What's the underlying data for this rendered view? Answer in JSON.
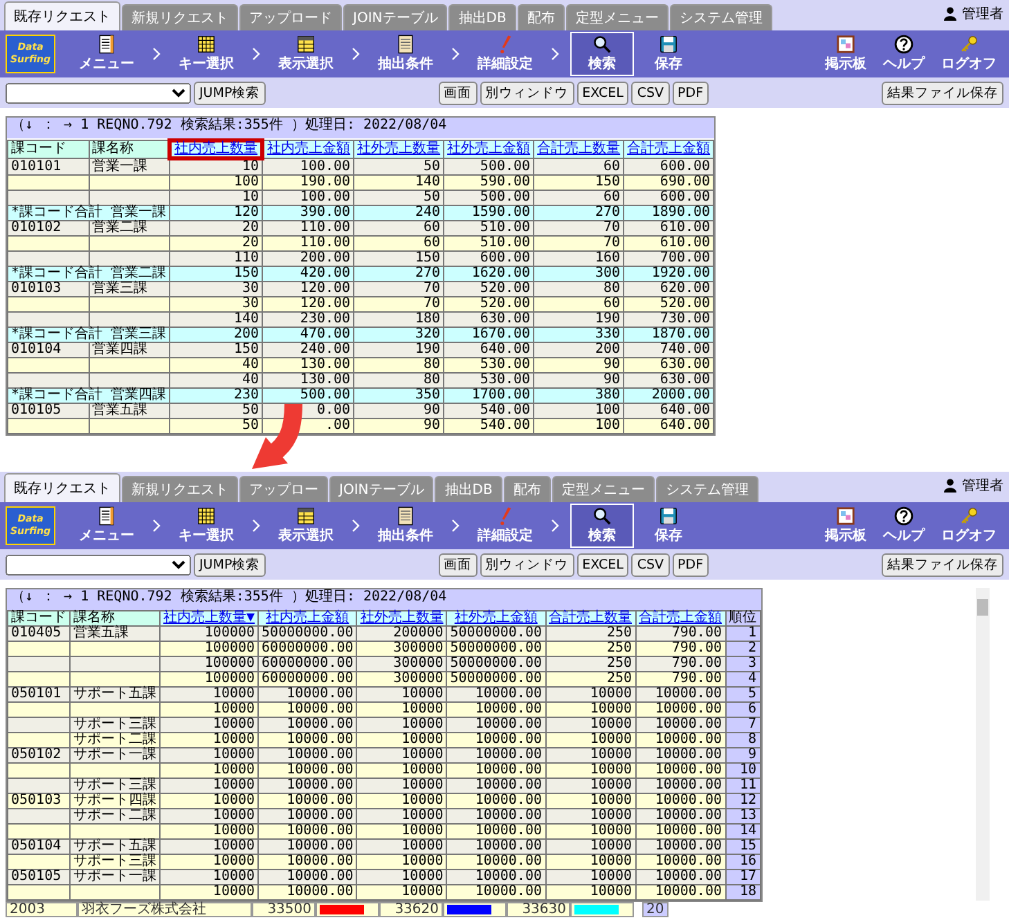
{
  "screens": [
    {
      "tabs": [
        {
          "label": "既存リクエスト",
          "selected": true
        },
        {
          "label": "新規リクエスト",
          "selected": false
        },
        {
          "label": "アップロード",
          "selected": false
        },
        {
          "label": "JOINテーブル",
          "selected": false
        },
        {
          "label": "抽出DB",
          "selected": false
        },
        {
          "label": "配布",
          "selected": false
        },
        {
          "label": "定型メニュー",
          "selected": false
        },
        {
          "label": "システム管理",
          "selected": false
        }
      ],
      "user": "管理者",
      "logo": "Data Surfing",
      "steps": [
        "メニュー",
        "キー選択",
        "表示選択",
        "抽出条件",
        "詳細設定"
      ],
      "tools": [
        {
          "label": "検索",
          "selected": true
        },
        {
          "label": "保存",
          "selected": false
        }
      ],
      "right_tools": [
        "掲示板",
        "ヘルプ",
        "ログオフ"
      ],
      "jump_button": "JUMP検索",
      "view_buttons": [
        "画面",
        "別ウィンドウ",
        "EXCEL",
        "CSV",
        "PDF"
      ],
      "save_button": "結果ファイル保存",
      "info": "（↓ ： → 1 REQNO.792 検索結果:355件 ）処理日: 2022/08/04",
      "table": {
        "columns": [
          {
            "label": "課コード",
            "kind": "key",
            "highlighted": false
          },
          {
            "label": "課名称",
            "kind": "key",
            "highlighted": false
          },
          {
            "label": "社内売上数量",
            "kind": "link",
            "highlighted": true
          },
          {
            "label": "社内売上金額",
            "kind": "link",
            "highlighted": false
          },
          {
            "label": "社外売上数量",
            "kind": "link",
            "highlighted": false
          },
          {
            "label": "社外売上金額",
            "kind": "link",
            "highlighted": false
          },
          {
            "label": "合計売上数量",
            "kind": "link",
            "highlighted": false
          },
          {
            "label": "合計売上金額",
            "kind": "link",
            "highlighted": false
          }
        ],
        "rows": [
          {
            "kind": "detail",
            "cells": [
              "010101",
              "営業一課",
              "10",
              "100.00",
              "50",
              "500.00",
              "60",
              "600.00"
            ]
          },
          {
            "kind": "detail",
            "cells": [
              "",
              "",
              "100",
              "190.00",
              "140",
              "590.00",
              "150",
              "690.00"
            ]
          },
          {
            "kind": "detail",
            "cells": [
              "",
              "",
              "10",
              "100.00",
              "50",
              "500.00",
              "60",
              "600.00"
            ]
          },
          {
            "kind": "subtotal",
            "cells": [
              {
                "text": "*課コード合計 営業一課",
                "colspan": 2
              },
              "120",
              "390.00",
              "240",
              "1590.00",
              "270",
              "1890.00"
            ]
          },
          {
            "kind": "detail",
            "cells": [
              "010102",
              "営業二課",
              "20",
              "110.00",
              "60",
              "510.00",
              "70",
              "610.00"
            ]
          },
          {
            "kind": "detail",
            "cells": [
              "",
              "",
              "20",
              "110.00",
              "60",
              "510.00",
              "70",
              "610.00"
            ]
          },
          {
            "kind": "detail",
            "cells": [
              "",
              "",
              "110",
              "200.00",
              "150",
              "600.00",
              "160",
              "700.00"
            ]
          },
          {
            "kind": "subtotal",
            "cells": [
              {
                "text": "*課コード合計 営業二課",
                "colspan": 2
              },
              "150",
              "420.00",
              "270",
              "1620.00",
              "300",
              "1920.00"
            ]
          },
          {
            "kind": "detail",
            "cells": [
              "010103",
              "営業三課",
              "30",
              "120.00",
              "70",
              "520.00",
              "80",
              "620.00"
            ]
          },
          {
            "kind": "detail",
            "cells": [
              "",
              "",
              "30",
              "120.00",
              "70",
              "520.00",
              "60",
              "520.00"
            ]
          },
          {
            "kind": "detail",
            "cells": [
              "",
              "",
              "140",
              "230.00",
              "180",
              "630.00",
              "190",
              "730.00"
            ]
          },
          {
            "kind": "subtotal",
            "cells": [
              {
                "text": "*課コード合計 営業三課",
                "colspan": 2
              },
              "200",
              "470.00",
              "320",
              "1670.00",
              "330",
              "1870.00"
            ]
          },
          {
            "kind": "detail",
            "cells": [
              "010104",
              "営業四課",
              "150",
              "240.00",
              "190",
              "640.00",
              "200",
              "740.00"
            ]
          },
          {
            "kind": "detail",
            "cells": [
              "",
              "",
              "40",
              "130.00",
              "80",
              "530.00",
              "90",
              "630.00"
            ]
          },
          {
            "kind": "detail",
            "cells": [
              "",
              "",
              "40",
              "130.00",
              "80",
              "530.00",
              "90",
              "630.00"
            ]
          },
          {
            "kind": "subtotal",
            "cells": [
              {
                "text": "*課コード合計 営業四課",
                "colspan": 2
              },
              "230",
              "500.00",
              "350",
              "1700.00",
              "380",
              "2000.00"
            ]
          },
          {
            "kind": "detail",
            "cells": [
              "010105",
              "営業五課",
              "50",
              "0.00",
              "90",
              "540.00",
              "100",
              "640.00"
            ]
          },
          {
            "kind": "detail",
            "cells": [
              "",
              "",
              "50",
              ".00",
              "90",
              "540.00",
              "100",
              "640.00"
            ]
          }
        ]
      }
    },
    {
      "tabs": [
        {
          "label": "既存リクエスト",
          "selected": true
        },
        {
          "label": "新規リクエスト",
          "selected": false
        },
        {
          "label": "アップロー",
          "selected": false
        },
        {
          "label": "JOINテーブル",
          "selected": false
        },
        {
          "label": "抽出DB",
          "selected": false
        },
        {
          "label": "配布",
          "selected": false
        },
        {
          "label": "定型メニュー",
          "selected": false
        },
        {
          "label": "システム管理",
          "selected": false
        }
      ],
      "user": "管理者",
      "logo": "Data Surfing",
      "steps": [
        "メニュー",
        "キー選択",
        "表示選択",
        "抽出条件",
        "詳細設定"
      ],
      "tools": [
        {
          "label": "検索",
          "selected": true
        },
        {
          "label": "保存",
          "selected": false
        }
      ],
      "right_tools": [
        "掲示板",
        "ヘルプ",
        "ログオフ"
      ],
      "jump_button": "JUMP検索",
      "view_buttons": [
        "画面",
        "別ウィンドウ",
        "EXCEL",
        "CSV",
        "PDF"
      ],
      "save_button": "結果ファイル保存",
      "info": "（↓ ： → 1 REQNO.792 検索結果:355件 ）処理日: 2022/08/04",
      "scrollable": true,
      "table": {
        "columns": [
          {
            "label": "課コード",
            "kind": "key",
            "highlighted": false
          },
          {
            "label": "課名称",
            "kind": "key",
            "highlighted": false
          },
          {
            "label": "社内売上数量▼",
            "kind": "link",
            "highlighted": false
          },
          {
            "label": "社内売上金額",
            "kind": "link",
            "highlighted": false
          },
          {
            "label": "社外売上数量",
            "kind": "link",
            "highlighted": false
          },
          {
            "label": "社外売上金額",
            "kind": "link",
            "highlighted": false
          },
          {
            "label": "合計売上数量",
            "kind": "link",
            "highlighted": false
          },
          {
            "label": "合計売上金額",
            "kind": "link",
            "highlighted": false
          },
          {
            "label": "順位",
            "kind": "rank",
            "highlighted": false
          }
        ],
        "rows": [
          {
            "kind": "detail",
            "cells": [
              "010405",
              "営業五課",
              "100000",
              "50000000.00",
              "200000",
              "50000000.00",
              "250",
              "790.00",
              "1"
            ]
          },
          {
            "kind": "detail",
            "cells": [
              "",
              "",
              "100000",
              "60000000.00",
              "300000",
              "50000000.00",
              "250",
              "790.00",
              "2"
            ]
          },
          {
            "kind": "detail",
            "cells": [
              "",
              "",
              "100000",
              "60000000.00",
              "300000",
              "50000000.00",
              "250",
              "790.00",
              "3"
            ]
          },
          {
            "kind": "detail",
            "cells": [
              "",
              "",
              "100000",
              "60000000.00",
              "300000",
              "50000000.00",
              "250",
              "790.00",
              "4"
            ]
          },
          {
            "kind": "detail",
            "cells": [
              "050101",
              "サポート五課",
              "10000",
              "10000.00",
              "10000",
              "10000.00",
              "10000",
              "10000.00",
              "5"
            ]
          },
          {
            "kind": "detail",
            "cells": [
              "",
              "",
              "10000",
              "10000.00",
              "10000",
              "10000.00",
              "10000",
              "10000.00",
              "6"
            ]
          },
          {
            "kind": "detail",
            "cells": [
              "",
              "サポート三課",
              "10000",
              "10000.00",
              "10000",
              "10000.00",
              "10000",
              "10000.00",
              "7"
            ]
          },
          {
            "kind": "detail",
            "cells": [
              "",
              "サポート二課",
              "10000",
              "10000.00",
              "10000",
              "10000.00",
              "10000",
              "10000.00",
              "8"
            ]
          },
          {
            "kind": "detail",
            "cells": [
              "050102",
              "サポート一課",
              "10000",
              "10000.00",
              "10000",
              "10000.00",
              "10000",
              "10000.00",
              "9"
            ]
          },
          {
            "kind": "detail",
            "cells": [
              "",
              "",
              "10000",
              "10000.00",
              "10000",
              "10000.00",
              "10000",
              "10000.00",
              "10"
            ]
          },
          {
            "kind": "detail",
            "cells": [
              "",
              "サポート三課",
              "10000",
              "10000.00",
              "10000",
              "10000.00",
              "10000",
              "10000.00",
              "11"
            ]
          },
          {
            "kind": "detail",
            "cells": [
              "050103",
              "サポート四課",
              "10000",
              "10000.00",
              "10000",
              "10000.00",
              "10000",
              "10000.00",
              "12"
            ]
          },
          {
            "kind": "detail",
            "cells": [
              "",
              "サポート二課",
              "10000",
              "10000.00",
              "10000",
              "10000.00",
              "10000",
              "10000.00",
              "13"
            ]
          },
          {
            "kind": "detail",
            "cells": [
              "",
              "",
              "10000",
              "10000.00",
              "10000",
              "10000.00",
              "10000",
              "10000.00",
              "14"
            ]
          },
          {
            "kind": "detail",
            "cells": [
              "050104",
              "サポート五課",
              "10000",
              "10000.00",
              "10000",
              "10000.00",
              "10000",
              "10000.00",
              "15"
            ]
          },
          {
            "kind": "detail",
            "cells": [
              "",
              "サポート三課",
              "10000",
              "10000.00",
              "10000",
              "10000.00",
              "10000",
              "10000.00",
              "16"
            ]
          },
          {
            "kind": "detail",
            "cells": [
              "050105",
              "サポート一課",
              "10000",
              "10000.00",
              "10000",
              "10000.00",
              "10000",
              "10000.00",
              "17"
            ]
          },
          {
            "kind": "detail",
            "cells": [
              "",
              "",
              "10000",
              "10000.00",
              "10000",
              "10000.00",
              "10000",
              "10000.00",
              "18"
            ]
          }
        ]
      },
      "strip": {
        "code": "2003",
        "name": "羽衣フーズ株式会社",
        "rank": "20",
        "values": [
          {
            "value": "33500",
            "color": "#ff0000"
          },
          {
            "value": "33620",
            "color": "#0000ff"
          },
          {
            "value": "33630",
            "color": "#00ffff"
          }
        ]
      }
    }
  ]
}
